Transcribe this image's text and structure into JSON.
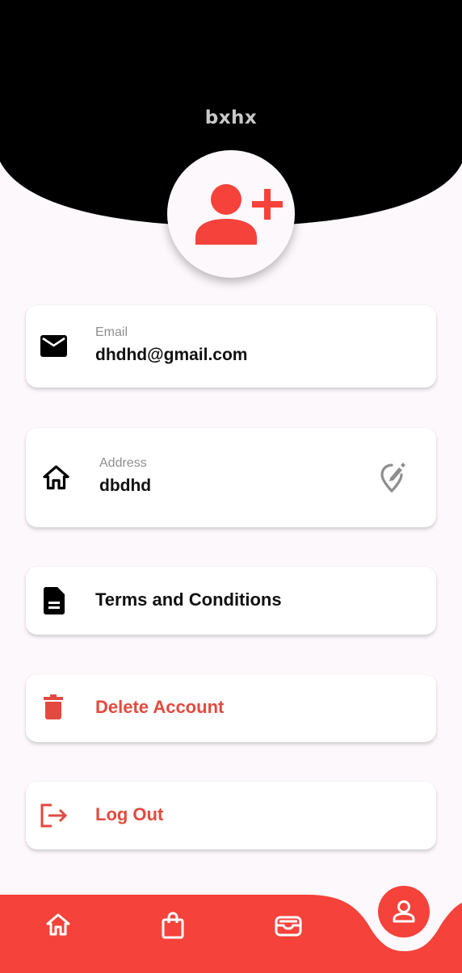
{
  "colors": {
    "accent": "#f5423a",
    "header_background": "#000000",
    "page_background": "#fcf8fc",
    "card_background": "#ffffff"
  },
  "profile": {
    "name": "bxhx",
    "avatar_icon": "add-person-icon"
  },
  "email_card": {
    "label": "Email",
    "value": "dhdhd@gmail.com",
    "icon": "mail-icon"
  },
  "address_card": {
    "label": "Address",
    "value": "dbdhd",
    "icon": "home-icon",
    "action_icon": "edit-location-icon"
  },
  "terms_card": {
    "label": "Terms and Conditions",
    "icon": "document-icon"
  },
  "delete_card": {
    "label": "Delete Account",
    "icon": "trash-icon"
  },
  "logout_card": {
    "label": "Log Out",
    "icon": "logout-icon"
  },
  "bottom_nav": {
    "items": [
      {
        "icon": "home-icon"
      },
      {
        "icon": "shopping-bag-icon"
      },
      {
        "icon": "wallet-icon"
      },
      {
        "icon": "profile-icon",
        "active": true
      }
    ]
  }
}
